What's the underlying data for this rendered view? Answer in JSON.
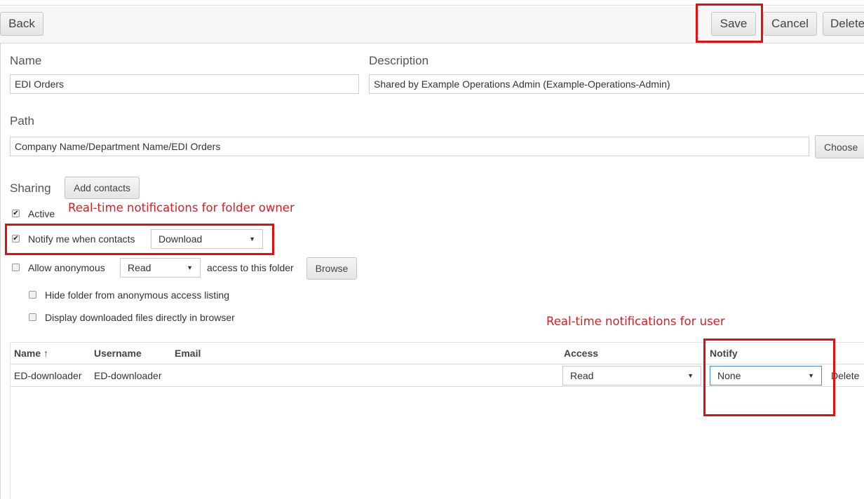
{
  "toolbar": {
    "back_label": "Back",
    "save_label": "Save",
    "cancel_label": "Cancel",
    "delete_label": "Delete"
  },
  "form": {
    "name_label": "Name",
    "name_value": "EDI Orders",
    "description_label": "Description",
    "description_value": "Shared by Example Operations Admin (Example-Operations-Admin)",
    "path_label": "Path",
    "path_value": "Company Name/Department Name/EDI Orders",
    "choose_label": "Choose"
  },
  "sharing": {
    "label": "Sharing",
    "add_contacts_label": "Add contacts",
    "active_label": "Active",
    "active_checked": true,
    "notify_label": "Notify me when contacts",
    "notify_checked": true,
    "notify_selected": "Download",
    "anon_label": "Allow anonymous",
    "anon_checked": false,
    "anon_selected": "Read",
    "anon_suffix": "access to this folder",
    "browse_label": "Browse",
    "hide_label": "Hide folder from anonymous access listing",
    "hide_checked": false,
    "display_label": "Display downloaded files directly in browser",
    "display_checked": false
  },
  "annotations": {
    "owner_note": "Real-time notifications for folder owner",
    "user_note": "Real-time notifications for user",
    "color": "#e40d10"
  },
  "contacts_table": {
    "headers": {
      "name": "Name ↑",
      "username": "Username",
      "email": "Email",
      "access": "Access",
      "notify": "Notify"
    },
    "rows": [
      {
        "name": "ED-downloader",
        "username": "ED-downloader",
        "email": "",
        "access": "Read",
        "notify": "None",
        "delete_label": "Delete"
      }
    ]
  },
  "icons": {
    "dropdown": "▼",
    "check": "✔"
  }
}
